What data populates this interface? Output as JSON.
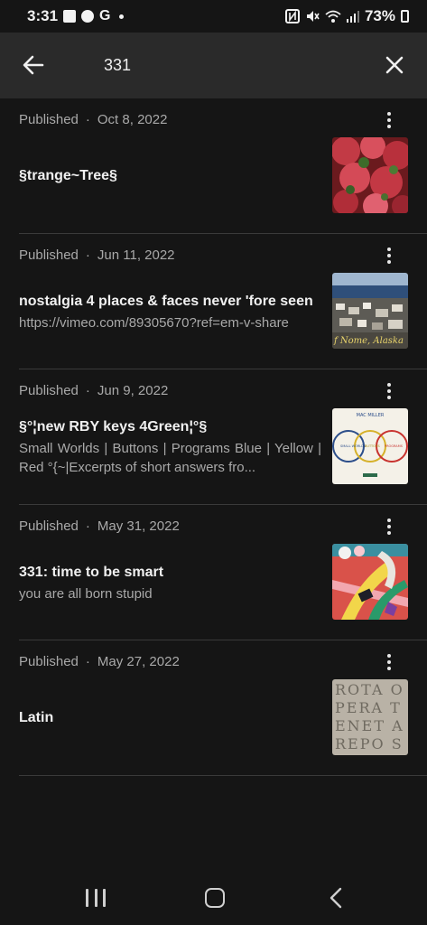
{
  "status_bar": {
    "time": "3:31",
    "carrier_letter": "G",
    "battery": "73%",
    "icons": [
      "image-icon",
      "messenger-icon",
      "google-icon",
      "nfc-icon",
      "mute-icon",
      "wifi-icon",
      "signal-icon",
      "battery-icon"
    ]
  },
  "header": {
    "query": "331",
    "back_icon": "arrow-left-icon",
    "close_icon": "close-icon"
  },
  "results": [
    {
      "status": "Published",
      "separator": "·",
      "date": "Oct 8, 2022",
      "title": "§trange~Tree§",
      "desc": ""
    },
    {
      "status": "Published",
      "separator": "·",
      "date": "Jun 11, 2022",
      "title": "nostalgia 4 places & faces never 'fore seen",
      "desc": "https://vimeo.com/89305670?ref=em-v-share",
      "thumb_caption": "f Nome, Alaska"
    },
    {
      "status": "Published",
      "separator": "·",
      "date": "Jun 9, 2022",
      "title": "§°¦new RBY keys 4Green¦°§",
      "desc": "Small Worlds | Buttons | Programs Blue | Yellow | Red °{~|Excerpts of short answers fro...",
      "thumb_heading": "MAC MILLER",
      "thumb_circles": [
        "SMALL WORLDS",
        "BUTTONS",
        "PROGRAMS"
      ]
    },
    {
      "status": "Published",
      "separator": "·",
      "date": "May 31, 2022",
      "title": "331: time to be smart",
      "desc": "you are all born stupid"
    },
    {
      "status": "Published",
      "separator": "·",
      "date": "May 27, 2022",
      "title": "Latin",
      "desc": "",
      "thumb_text": "ROTA OPERA TENET AREPO SATOR"
    }
  ],
  "colors": {
    "background": "#151515",
    "header": "#2a2a2a",
    "muted_text": "#a9a9a9",
    "divider": "#3a3a3a"
  }
}
